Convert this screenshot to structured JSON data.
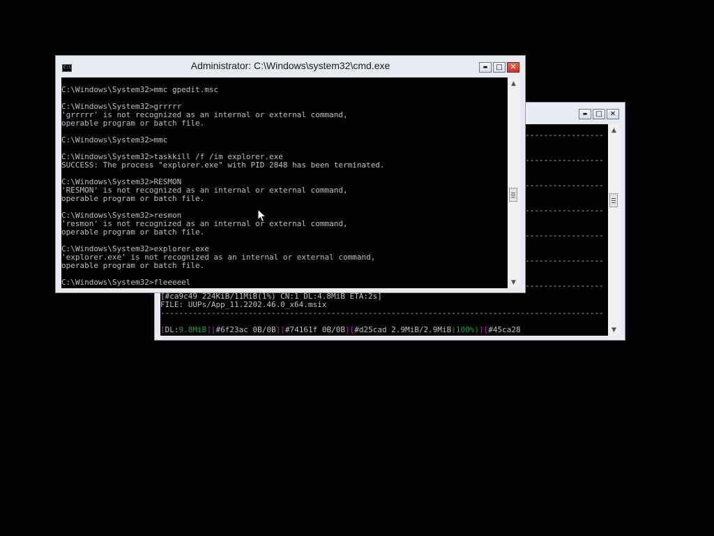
{
  "back_window": {
    "controls": {
      "minimize": "▬",
      "maximize": "□",
      "close": "✕"
    },
    "dash_line": "------------------------------------------------------------------------------------------------",
    "partial_line": "[#ca9c49 224KiB/11MiB(1%) CN:1 DL:4.8MiB ETA:2s]",
    "file_line": "FILE: UUPs/App_11.2202.46.0_x64.msix",
    "status": {
      "dl_label": "DL:",
      "dl_value": "9.8MiB",
      "items": [
        {
          "id": "#6f23ac",
          "text": " 0B/0B"
        },
        {
          "id": "#74161f",
          "text": " 0B/0B"
        },
        {
          "id": "#d25cad",
          "text": " 2.9MiB/2.9MiB",
          "pct": "100%"
        },
        {
          "id": "#45ca28",
          "text": ""
        }
      ]
    },
    "colors": {
      "bracket": "#b0259e",
      "green": "#1aa34a"
    }
  },
  "cmd_window": {
    "title": "Administrator: C:\\Windows\\system32\\cmd.exe",
    "icon_text": "C:\\",
    "controls": {
      "minimize": "▬",
      "maximize": "□",
      "close": "✕"
    },
    "lines": [
      "C:\\Windows\\System32>mmc gpedit.msc",
      "",
      "C:\\Windows\\System32>grrrrr",
      "'grrrrr' is not recognized as an internal or external command,",
      "operable program or batch file.",
      "",
      "C:\\Windows\\System32>mmc",
      "",
      "C:\\Windows\\System32>taskkill /f /im explorer.exe",
      "SUCCESS: The process \"explorer.exe\" with PID 2848 has been terminated.",
      "",
      "C:\\Windows\\System32>RESMON",
      "'RESMON' is not recognized as an internal or external command,",
      "operable program or batch file.",
      "",
      "C:\\Windows\\System32>resmon",
      "'resmon' is not recognized as an internal or external command,",
      "operable program or batch file.",
      "",
      "C:\\Windows\\System32>explorer.exe",
      "'explorer.exe' is not recognized as an internal or external command,",
      "operable program or batch file.",
      "",
      "C:\\Windows\\System32>fleeeeel"
    ]
  }
}
